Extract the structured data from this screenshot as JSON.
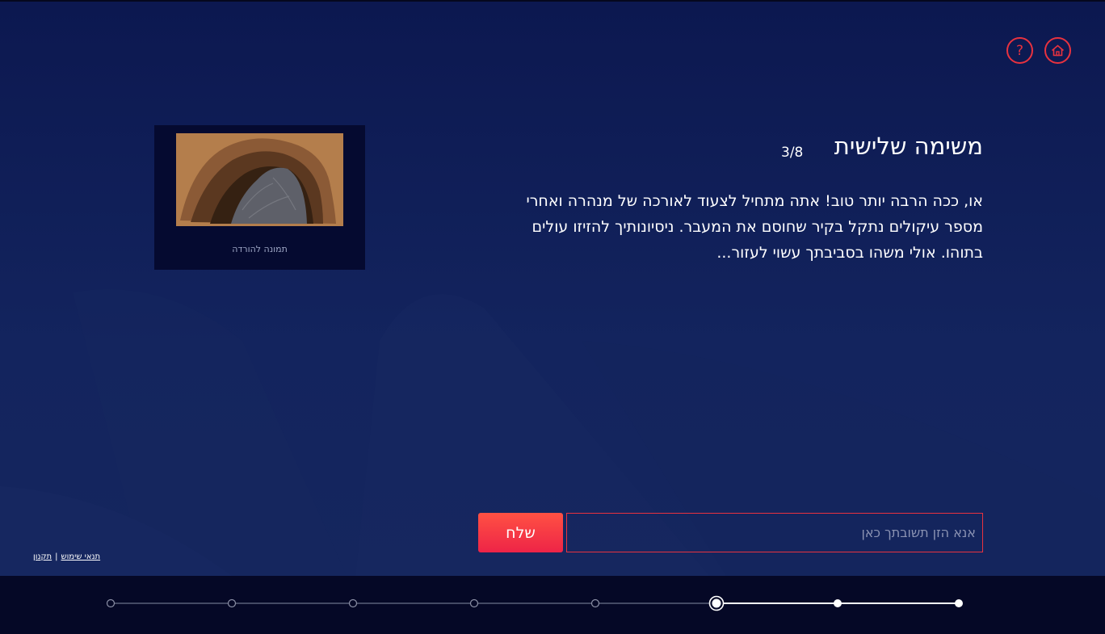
{
  "header": {
    "help_icon_glyph": "?",
    "home_icon": "home-icon"
  },
  "task": {
    "title": "משימה שלישית",
    "progress": "3/8",
    "body": "או, ככה הרבה יותר טוב! אתה מתחיל לצעוד לאורכה של מנהרה ואחרי מספר עיקולים נתקל בקיר שחוסם את המעבר. ניסיונותיך להזיזו עולים בתוהו. אולי משהו בסביבתך עשוי לעזור..."
  },
  "image_card": {
    "image_description": "cave-entrance-illustration",
    "download_label": "תמונה להורדה"
  },
  "answer": {
    "placeholder": "אנא הזן תשובתך כאן",
    "value": "",
    "submit_label": "שלח"
  },
  "footer": {
    "terms_label": "תנאי שימוש",
    "separator": "|",
    "rules_label": "תקנון"
  },
  "progress_track": {
    "total_steps": 8,
    "completed_steps": 2,
    "current_step": 3
  },
  "colors": {
    "accent": "#e8323f",
    "background": "#0d1a4f",
    "bottom_bar": "#050826"
  }
}
